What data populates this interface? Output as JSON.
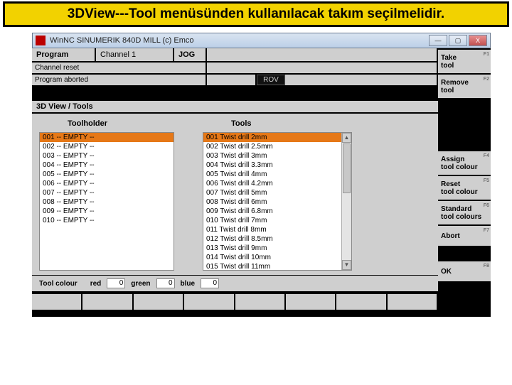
{
  "banner": "3DView---Tool menüsünden kullanılacak takım seçilmelidir.",
  "window": {
    "title": "WinNC SINUMERIK 840D MILL (c) Emco",
    "min": "—",
    "max": "▢",
    "close": "X"
  },
  "header": {
    "program": "Program",
    "channel": "Channel 1",
    "mode": "JOG",
    "reset": "Channel reset",
    "aborted": "Program aborted",
    "rov": "ROV"
  },
  "view_title": "3D View / Tools",
  "lists": {
    "toolholder_label": "Toolholder",
    "tools_label": "Tools",
    "toolholder": [
      "001 -- EMPTY --",
      "002 -- EMPTY --",
      "003 -- EMPTY --",
      "004 -- EMPTY --",
      "005 -- EMPTY --",
      "006 -- EMPTY --",
      "007 -- EMPTY --",
      "008 -- EMPTY --",
      "009 -- EMPTY --",
      "010 -- EMPTY --"
    ],
    "tools": [
      "001 Twist drill 2mm",
      "002 Twist drill 2.5mm",
      "003 Twist drill 3mm",
      "004 Twist drill 3.3mm",
      "005 Twist drill 4mm",
      "006 Twist drill 4.2mm",
      "007 Twist drill 5mm",
      "008 Twist drill 6mm",
      "009 Twist drill 6.8mm",
      "010 Twist drill 7mm",
      "011 Twist drill 8mm",
      "012 Twist drill 8.5mm",
      "013 Twist drill 9mm",
      "014 Twist drill 10mm",
      "015 Twist drill 11mm"
    ]
  },
  "color": {
    "label": "Tool colour",
    "red_label": "red",
    "red": "0",
    "green_label": "green",
    "green": "0",
    "blue_label": "blue",
    "blue": "0"
  },
  "softkeys": {
    "f1a": "Take",
    "f1b": "tool",
    "f1": "F1",
    "f2a": "Remove",
    "f2b": "tool",
    "f2": "F2",
    "f4a": "Assign",
    "f4b": "tool colour",
    "f4": "F4",
    "f5a": "Reset",
    "f5b": "tool colour",
    "f5": "F5",
    "f6a": "Standard",
    "f6b": "tool colours",
    "f6": "F6",
    "f7a": "Abort",
    "f7": "F7",
    "f8a": "OK",
    "f8": "F8"
  }
}
